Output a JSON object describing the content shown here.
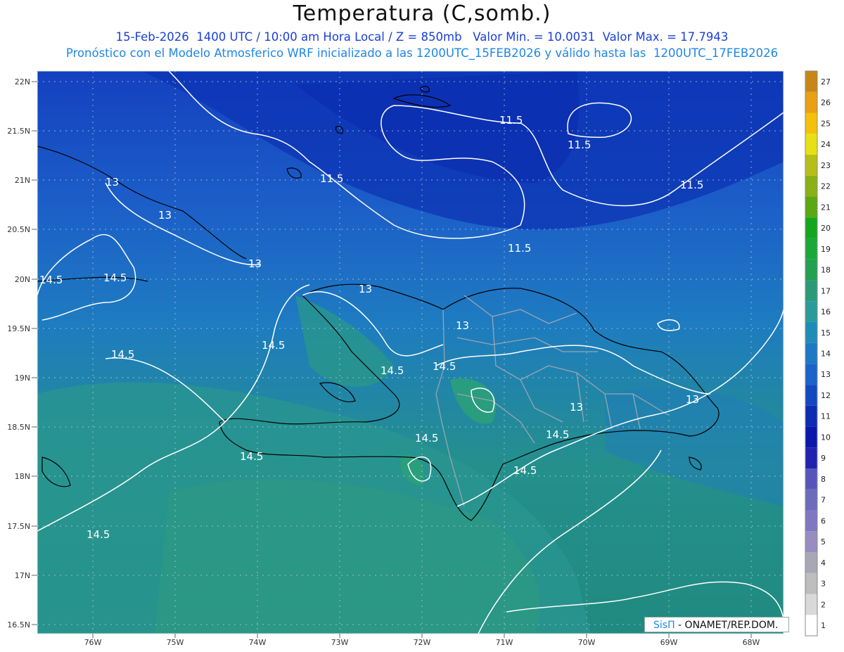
{
  "header": {
    "title": "Temperatura (C,somb.)",
    "line1": "15-Feb-2026  1400 UTC / 10:00 am Hora Local / Z = 850mb   Valor Min. = 10.0031  Valor Max. = 17.7943",
    "line2": "Pronóstico con el Modelo Atmosferico WRF inicializado a las 1200UTC_15FEB2026 y válido hasta las  1200UTC_17FEB2026"
  },
  "map": {
    "lat_labels": [
      "22N",
      "21.5N",
      "21N",
      "20.5N",
      "20N",
      "19.5N",
      "19N",
      "18.5N",
      "18N",
      "17.5N",
      "17N",
      "16.5N"
    ],
    "lon_labels": [
      "76W",
      "75W",
      "74W",
      "73W",
      "72W",
      "71W",
      "70W",
      "69W",
      "68W"
    ],
    "contour_labels": [
      "11.5",
      "11.5",
      "11.5",
      "11.5",
      "11.5",
      "13",
      "13",
      "13",
      "13",
      "13",
      "13",
      "13",
      "14.5",
      "14.5",
      "14.5",
      "14.5",
      "14.5",
      "14.5",
      "14.5",
      "14.5",
      "14.5",
      "14.5",
      "14.5"
    ]
  },
  "colorbar": {
    "levels": [
      "1",
      "2",
      "3",
      "4",
      "5",
      "6",
      "7",
      "8",
      "9",
      "10",
      "11",
      "12",
      "13",
      "14",
      "15",
      "16",
      "17",
      "18",
      "19",
      "20",
      "21",
      "22",
      "23",
      "24",
      "25",
      "26",
      "27"
    ],
    "colors": [
      "#ffffff",
      "#d9d9d9",
      "#bdbdbd",
      "#a8a8b4",
      "#9a8cc0",
      "#7f78c0",
      "#6c6cbc",
      "#5656b8",
      "#2222b0",
      "#0c18ac",
      "#0c2cb4",
      "#1448c0",
      "#1c62c8",
      "#1e78c4",
      "#1f8cb8",
      "#2a9a9a",
      "#2c9a78",
      "#24a050",
      "#1aa838",
      "#14a61e",
      "#5aa812",
      "#8ab018",
      "#b8be18",
      "#e6e016",
      "#f4c00c",
      "#e8a014",
      "#c88618"
    ]
  },
  "credit": {
    "brand": "SisΠ",
    "text": " - ONAMET/REP.DOM."
  }
}
